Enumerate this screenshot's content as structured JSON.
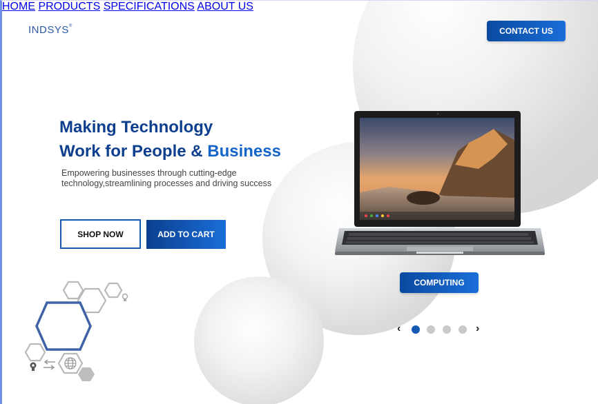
{
  "brand": {
    "name": "INDSYS",
    "mark": "®"
  },
  "nav": {
    "items": [
      "HOME",
      "PRODUCTS",
      "SPECIFICATIONS",
      "ABOUT US"
    ],
    "contact_label": "CONTACT US"
  },
  "hero": {
    "title_line1": "Making Technology",
    "title_line2a": "Work for People & ",
    "title_line2b": "Business",
    "subtitle": "Empowering businesses through cutting-edge technology,streamlining processes and driving success",
    "shop_label": "SHOP NOW",
    "cart_label": "ADD TO CART"
  },
  "product": {
    "category_label": "COMPUTING"
  },
  "carousel": {
    "total": 4,
    "active_index": 0,
    "prev": "‹",
    "next": "›"
  },
  "colors": {
    "primary": "#0a4aa0",
    "accent": "#1a6ed8",
    "title": "#0d3f8e",
    "dot_inactive": "#c9c9c9"
  },
  "icons": [
    "laptop-image",
    "hexagon-network-icon",
    "globe-icon",
    "gear-icon",
    "arrows-icon",
    "lightbulb-icon"
  ]
}
